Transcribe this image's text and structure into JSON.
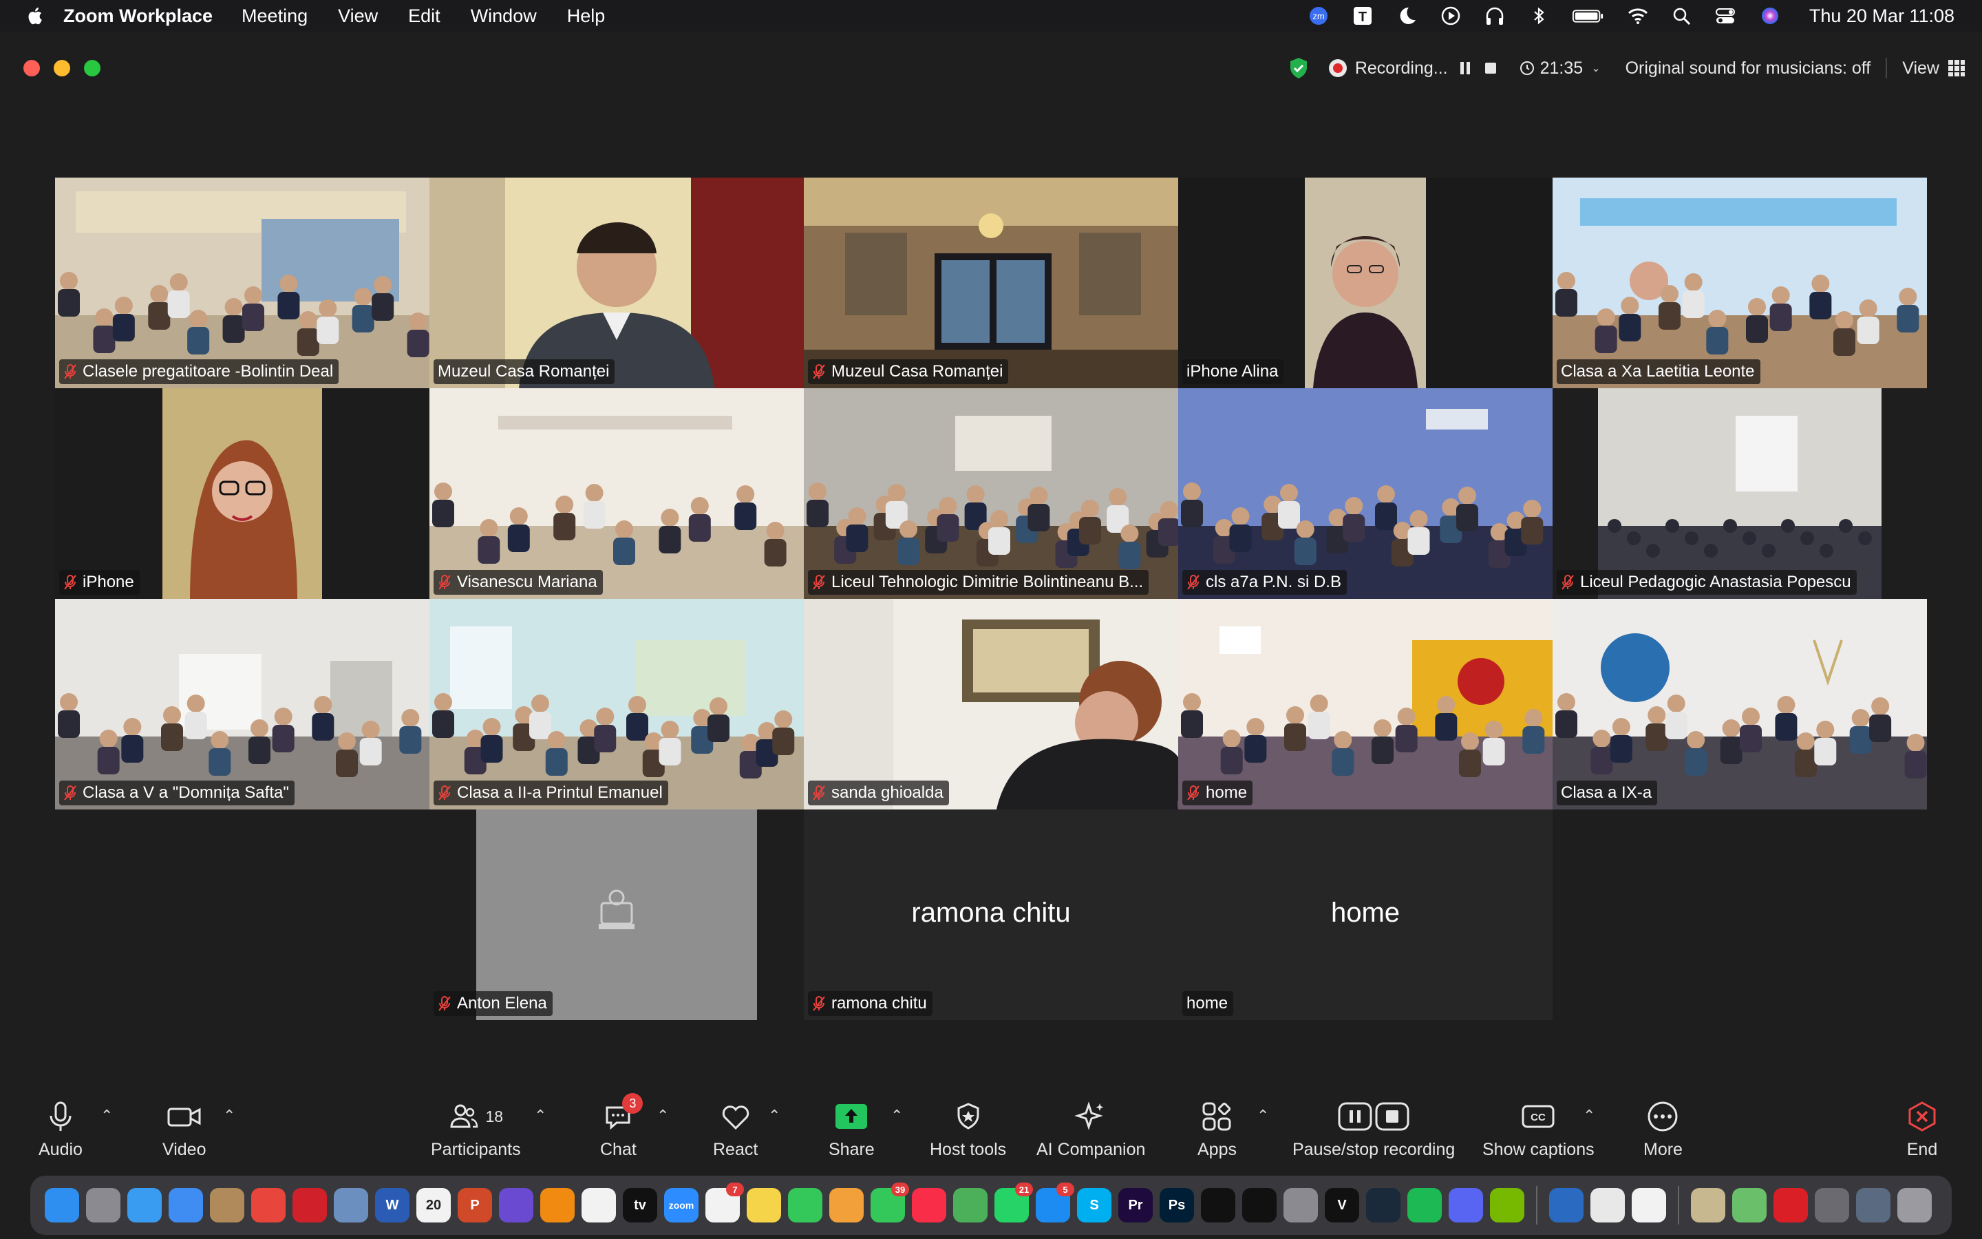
{
  "menubar": {
    "app_name": "Zoom Workplace",
    "menus": [
      "Meeting",
      "View",
      "Edit",
      "Window",
      "Help"
    ],
    "clock": "Thu 20 Mar  11:08",
    "status_icons": [
      "zoom-icon",
      "t-icon",
      "moon-icon",
      "play-icon",
      "headphones-icon",
      "bluetooth-icon",
      "battery-icon",
      "wifi-icon",
      "search-icon",
      "control-center-icon",
      "siri-icon"
    ],
    "zoom_badge": "zm",
    "t_badge": "T"
  },
  "window": {
    "recording_label": "Recording...",
    "timer": "21:35",
    "original_sound": "Original sound for musicians: off",
    "view_label": "View"
  },
  "tiles": [
    {
      "name": "Clasele pregatitoare -Bolintin Deal",
      "muted": true,
      "scene": "classroom-bright"
    },
    {
      "name": "Muzeul Casa Romanței",
      "muted": false,
      "scene": "man-suit"
    },
    {
      "name": "Muzeul Casa Romanței",
      "muted": true,
      "scene": "museum-hall"
    },
    {
      "name": "iPhone Alina",
      "muted": false,
      "scene": "woman-portrait",
      "speaking": true
    },
    {
      "name": "Clasa a Xa Laetitia Leonte",
      "muted": false,
      "scene": "classroom-blue"
    },
    {
      "name": "iPhone",
      "muted": true,
      "scene": "woman-glasses"
    },
    {
      "name": "Visanescu Mariana",
      "muted": true,
      "scene": "classroom-kids"
    },
    {
      "name": "Liceul Tehnologic Dimitrie Bolintineanu B...",
      "muted": true,
      "scene": "classroom-dark"
    },
    {
      "name": "cls a7a P.N. si D.B",
      "muted": true,
      "scene": "classroom-blue-dark"
    },
    {
      "name": "Liceul Pedagogic Anastasia Popescu",
      "muted": true,
      "scene": "classroom-wide"
    },
    {
      "name": "Clasa a V a \"Domnița Safta\"",
      "muted": true,
      "scene": "classroom-girls"
    },
    {
      "name": "Clasa a II-a Printul Emanuel",
      "muted": true,
      "scene": "classroom-uniform"
    },
    {
      "name": "sanda ghioalda",
      "muted": true,
      "scene": "older-woman"
    },
    {
      "name": "home",
      "muted": true,
      "scene": "classroom-mural"
    },
    {
      "name": "Clasa a IX-a",
      "muted": false,
      "scene": "classroom-wall"
    },
    {
      "name": "Anton Elena",
      "muted": true,
      "scene": "avatar-placeholder"
    },
    {
      "name": "ramona chitu",
      "muted": true,
      "scene": "name-only",
      "display_name": "ramona chitu"
    },
    {
      "name": "home",
      "muted": false,
      "scene": "name-only",
      "display_name": "home"
    }
  ],
  "toolbar": {
    "audio": "Audio",
    "video": "Video",
    "participants": "Participants",
    "participants_count": "18",
    "chat": "Chat",
    "chat_badge": "3",
    "react": "React",
    "share": "Share",
    "host_tools": "Host tools",
    "ai_companion": "AI Companion",
    "apps": "Apps",
    "pause_stop_recording": "Pause/stop recording",
    "show_captions": "Show captions",
    "captions_icon_text": "CC",
    "more": "More",
    "end": "End"
  },
  "dock": {
    "apps": [
      {
        "name": "finder",
        "color": "#2f8ff0"
      },
      {
        "name": "launchpad",
        "color": "#8a8a90"
      },
      {
        "name": "safari",
        "color": "#3a9cf0"
      },
      {
        "name": "mail",
        "color": "#3f8cf2"
      },
      {
        "name": "notes-brown",
        "color": "#b08a5a"
      },
      {
        "name": "chrome",
        "color": "#e8453c"
      },
      {
        "name": "opera",
        "color": "#d0202a"
      },
      {
        "name": "preview",
        "color": "#6b8fbf"
      },
      {
        "name": "word",
        "color": "#2b5cb5",
        "label": "W"
      },
      {
        "name": "calendar",
        "color": "#f2f2f2",
        "label": "20",
        "label_color": "#222"
      },
      {
        "name": "powerpoint",
        "color": "#d04a2a",
        "label": "P"
      },
      {
        "name": "siri",
        "color": "#6a4ad0"
      },
      {
        "name": "vlc",
        "color": "#f08a10"
      },
      {
        "name": "freeform",
        "color": "#f2f2f2"
      },
      {
        "name": "appletv",
        "color": "#111111",
        "label": "tv"
      },
      {
        "name": "zoom",
        "color": "#2d8cff",
        "label": "zoom"
      },
      {
        "name": "reminders",
        "color": "#f2f2f2",
        "badge": "7"
      },
      {
        "name": "notes",
        "color": "#f5d44a"
      },
      {
        "name": "facetime",
        "color": "#34c759"
      },
      {
        "name": "photos",
        "color": "#f2a03a"
      },
      {
        "name": "messages",
        "color": "#34c759",
        "badge": "39"
      },
      {
        "name": "music",
        "color": "#fa2d48"
      },
      {
        "name": "maps",
        "color": "#4cb05a"
      },
      {
        "name": "whatsapp",
        "color": "#25d366",
        "badge": "21"
      },
      {
        "name": "appstore",
        "color": "#1c8cf2",
        "badge": "5"
      },
      {
        "name": "skype",
        "color": "#00aff0",
        "label": "S"
      },
      {
        "name": "premiere",
        "color": "#1e0a3c",
        "label": "Pr"
      },
      {
        "name": "photoshop",
        "color": "#001e36",
        "label": "Ps"
      },
      {
        "name": "tiktok",
        "color": "#111111"
      },
      {
        "name": "capcut",
        "color": "#111111"
      },
      {
        "name": "system-settings",
        "color": "#8a8a90"
      },
      {
        "name": "vectorworks",
        "color": "#111111",
        "label": "V"
      },
      {
        "name": "audio-app",
        "color": "#1a2a3a"
      },
      {
        "name": "spotify",
        "color": "#1db954"
      },
      {
        "name": "discord",
        "color": "#5865f2"
      },
      {
        "name": "nvidia",
        "color": "#76b900"
      },
      {
        "name": "quicktime",
        "color": "#2a6ac0"
      },
      {
        "name": "app-store-alt",
        "color": "#e8e8e8"
      },
      {
        "name": "textedit",
        "color": "#f2f2f2"
      },
      {
        "name": "photo-folder",
        "color": "#c8b890"
      },
      {
        "name": "cloud-folder",
        "color": "#6ac06a"
      },
      {
        "name": "creative-cloud",
        "color": "#da1f26"
      },
      {
        "name": "screenshot-folder",
        "color": "#6a6a70"
      },
      {
        "name": "downloads-folder",
        "color": "#5a6a80"
      },
      {
        "name": "trash",
        "color": "#9a9aa0"
      }
    ]
  }
}
